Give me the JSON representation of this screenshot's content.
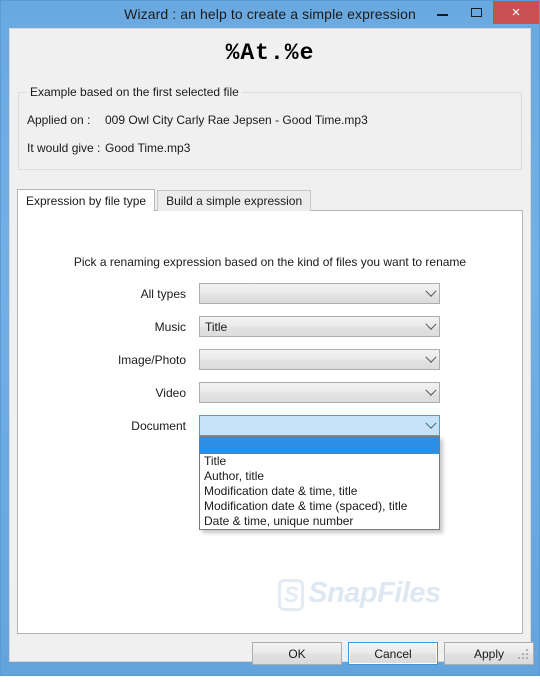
{
  "window": {
    "title": "Wizard : an help to create a simple expression",
    "controls": {
      "minimize": "–",
      "maximize": "□",
      "close": "×"
    },
    "colors": {
      "titlebar_blue": "#6aa9e0",
      "close_red": "#c75050",
      "selection_blue": "#2c8fe3",
      "combo_open_blue": "#c7e2f7",
      "focus_border": "#3c99d4"
    }
  },
  "expression": {
    "value": "%At.%e"
  },
  "example_group": {
    "title": "Example based on the first selected file",
    "applied_on_label": "Applied on :",
    "applied_on_value": "009 Owl City  Carly Rae Jepsen - Good Time.mp3",
    "would_give_label": "It would give :",
    "would_give_value": "Good Time.mp3"
  },
  "tabs": [
    {
      "label": "Expression by file type",
      "active": true
    },
    {
      "label": "Build a simple expression",
      "active": false
    }
  ],
  "panel": {
    "instruction": "Pick a renaming expression based on the kind of files you want to rename",
    "rows": [
      {
        "label": "All types",
        "value": "",
        "open": false
      },
      {
        "label": "Music",
        "value": "Title",
        "open": false
      },
      {
        "label": "Image/Photo",
        "value": "",
        "open": false
      },
      {
        "label": "Video",
        "value": "",
        "open": false
      },
      {
        "label": "Document",
        "value": "",
        "open": true
      }
    ]
  },
  "dropdown": {
    "selected_value": "",
    "options": [
      "Title",
      "Author, title",
      "Modification date & time, title",
      "Modification date & time (spaced), title",
      "Date & time, unique number"
    ]
  },
  "watermark": {
    "logo": "S",
    "text": "SnapFiles"
  },
  "buttons": {
    "ok": "OK",
    "cancel": "Cancel",
    "apply": "Apply"
  }
}
